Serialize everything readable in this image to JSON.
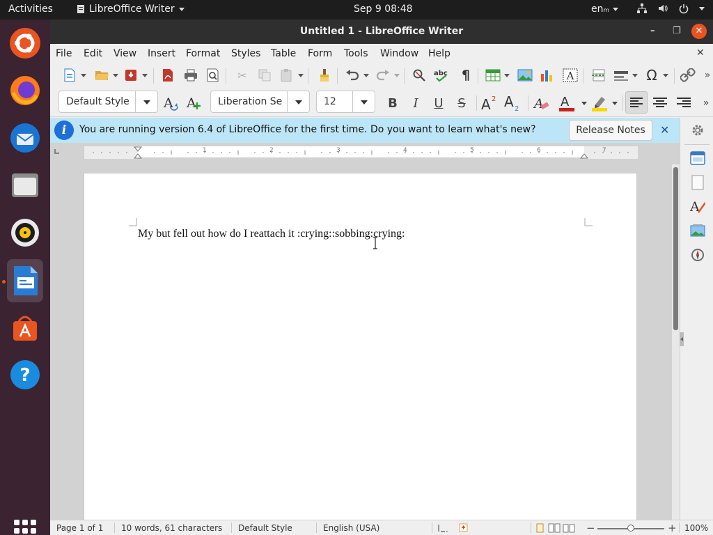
{
  "topbar": {
    "activities": "Activities",
    "app_menu": "LibreOffice Writer",
    "clock": "Sep 9  08:48",
    "lang": "enₘ"
  },
  "dock": {
    "items": [
      "ubuntu-logo-icon",
      "firefox-icon",
      "thunderbird-icon",
      "files-icon",
      "rhythmbox-icon",
      "writer-icon",
      "software-center-icon",
      "help-icon"
    ],
    "active": "writer-icon"
  },
  "window": {
    "title": "Untitled 1 - LibreOffice Writer"
  },
  "menu": {
    "items": [
      "File",
      "Edit",
      "View",
      "Insert",
      "Format",
      "Styles",
      "Table",
      "Form",
      "Tools",
      "Window",
      "Help"
    ]
  },
  "format_toolbar": {
    "paragraph_style": "Default Style",
    "font_name": "Liberation Se",
    "font_size": "12"
  },
  "infobar": {
    "message": "You are running version 6.4 of LibreOffice for the first time. Do you want to learn what's new?",
    "button": "Release Notes",
    "close": "✕"
  },
  "document": {
    "text": "My but fell out how do I reattach it :crying::sobbing:crying:"
  },
  "ruler": {
    "numbers": [
      "1",
      "2",
      "3",
      "4",
      "5",
      "6",
      "7"
    ]
  },
  "status": {
    "page": "Page 1 of 1",
    "words": "10 words, 61 characters",
    "style": "Default Style",
    "language": "English (USA)",
    "zoom": "100%"
  },
  "colors": {
    "accent": "#e95420",
    "infobar_bg": "#bde5f8",
    "dock_bg": "#3b2332",
    "font_color": "#c9211e",
    "highlight_color": "#ffd500"
  }
}
